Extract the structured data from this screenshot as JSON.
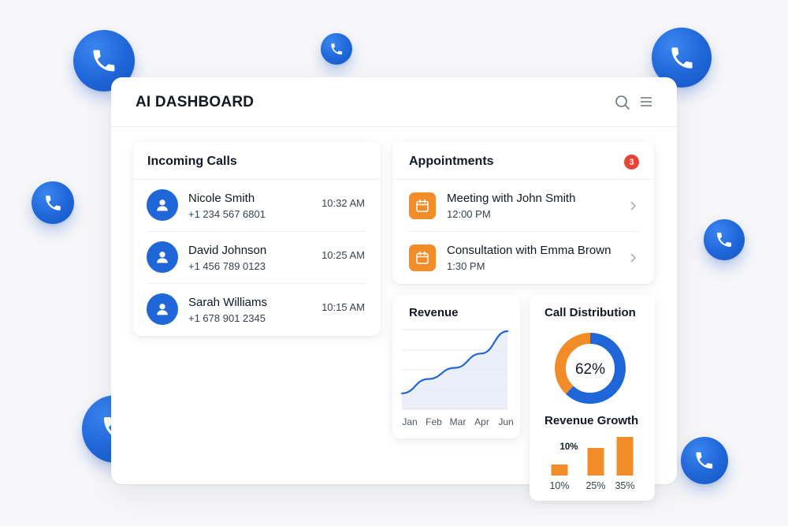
{
  "header": {
    "title": "AI DASHBOARD",
    "search_icon": "search-icon",
    "menu_icon": "menu-icon"
  },
  "incoming_calls": {
    "title": "Incoming Calls",
    "items": [
      {
        "name": "Nicole Smith",
        "phone": "+1 234 567 6801",
        "time": "10:32 AM"
      },
      {
        "name": "David Johnson",
        "phone": "+1 456 789 0123",
        "time": "10:25 AM"
      },
      {
        "name": "Sarah Williams",
        "phone": "+1 678 901 2345",
        "time": "10:15 AM"
      }
    ]
  },
  "appointments": {
    "title": "Appointments",
    "count": "3",
    "items": [
      {
        "title": "Meeting with John Smith",
        "time": "12:00 PM"
      },
      {
        "title": "Consultation with Emma Brown",
        "time": "1:30 PM"
      }
    ]
  },
  "revenue": {
    "title": "Revenue",
    "chart_data": {
      "type": "area",
      "categories": [
        "Jan",
        "Feb",
        "Mar",
        "Apr",
        "Jun"
      ],
      "values": [
        20,
        38,
        52,
        70,
        98
      ],
      "ylim": [
        0,
        100
      ],
      "grid": true
    }
  },
  "call_distribution": {
    "title": "Call Distribution",
    "center_label": "62%",
    "chart_data": {
      "type": "pie",
      "values": [
        62,
        38
      ],
      "colors": [
        "#1f66d9",
        "#f28c28"
      ]
    }
  },
  "revenue_growth": {
    "title": "Revenue Growth",
    "top_label": "10%",
    "chart_data": {
      "type": "bar",
      "categories": [
        "10%",
        "25%",
        "35%"
      ],
      "values": [
        10,
        25,
        35
      ],
      "ylim": [
        0,
        35
      ]
    }
  },
  "colors": {
    "primary": "#1f66d9",
    "accent": "#f28c28",
    "badge": "#ea4335"
  }
}
